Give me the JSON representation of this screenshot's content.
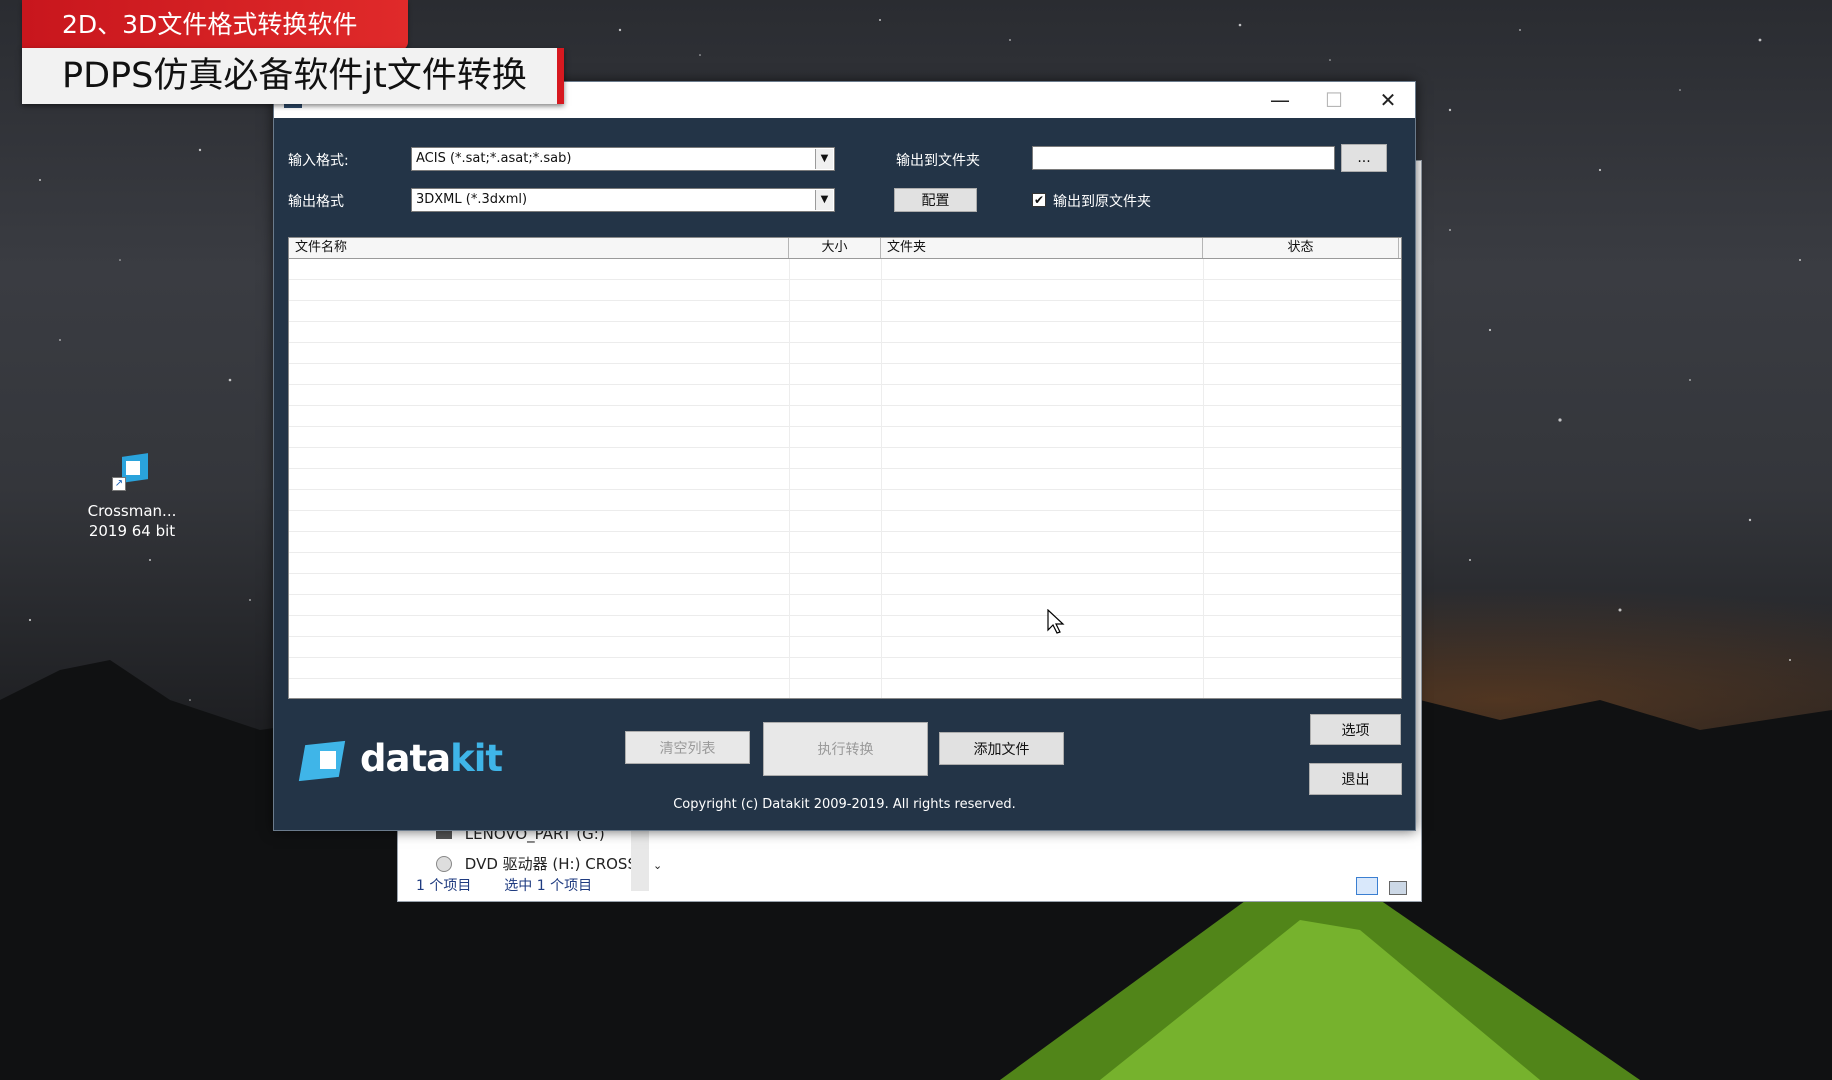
{
  "overlay": {
    "banner_top": "2D、3D文件格式转换软件",
    "banner_sub": "PDPS仿真必备软件jt文件转换"
  },
  "desktop": {
    "icon_label_1": "Crossman...",
    "icon_label_2": "2019 64 bit"
  },
  "explorer": {
    "drive_g": "LENOVO_PART (G:)",
    "drive_h": "DVD 驱动器 (H:) CROSSN",
    "status_items": "1 个项目",
    "status_selected": "选中 1 个项目"
  },
  "app": {
    "window_controls": {
      "minimize": "—",
      "maximize": "☐",
      "close": "✕"
    },
    "input_format_label": "输入格式:",
    "input_format_value": "ACIS (*.sat;*.asat;*.sab)",
    "output_format_label": "输出格式",
    "output_format_value": "3DXML (*.3dxml)",
    "output_folder_label": "输出到文件夹",
    "output_folder_value": "",
    "browse_label": "...",
    "config_label": "配置",
    "same_folder_checkbox": {
      "label": "输出到原文件夹",
      "checked": true
    },
    "table": {
      "columns": [
        "文件名称",
        "大小",
        "文件夹",
        "状态"
      ],
      "rows": []
    },
    "buttons": {
      "clear_list": "清空列表",
      "execute": "执行转换",
      "add_files": "添加文件",
      "options": "选项",
      "exit": "退出"
    },
    "logo": {
      "part1": "data",
      "part2": "kit"
    },
    "copyright": "Copyright (c) Datakit 2009-2019. All rights reserved."
  },
  "colors": {
    "app_background": "#233447",
    "logo_accent": "#3fb5e8",
    "banner_red": "#d71920"
  }
}
